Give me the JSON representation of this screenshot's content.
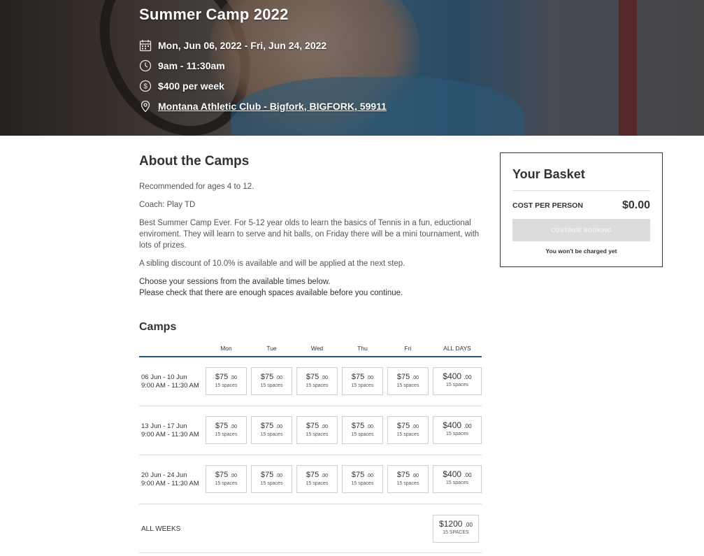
{
  "hero": {
    "title": "Summer Camp 2022",
    "dates": "Mon, Jun 06, 2022 - Fri, Jun 24, 2022",
    "time": "9am - 11:30am",
    "price": "$400 per week",
    "location": "Montana Athletic Club - Bigfork, BIGFORK, 59911",
    "icons": [
      "calendar-icon",
      "clock-icon",
      "dollar-icon",
      "location-pin-icon"
    ]
  },
  "about": {
    "heading": "About the Camps",
    "ages": "Recommended for ages 4 to 12.",
    "coach": "Coach: Play TD",
    "description": "Best Summer Camp Ever. For 5-12 year olds to learn the basics of Tennis in a fun, eductional enviroment. They will learn to serve and hit balls, on Friday there will be a mini tournament, with lots of prizes.",
    "discount": "A sibling discount of 10.0% is available and will be applied at the next step.",
    "instruction_1": "Choose your sessions from the available times below.",
    "instruction_2": "Please check that there are enough spaces available before you continue."
  },
  "basket": {
    "title": "Your Basket",
    "cost_label": "COST PER PERSON",
    "cost_value": "$0.00",
    "continue_label": "CONTINUE BOOKING",
    "note": "You won't be charged yet"
  },
  "camps": {
    "title": "Camps",
    "headers": [
      "Mon",
      "Tue",
      "Wed",
      "Thu",
      "Fri",
      "ALL DAYS"
    ],
    "weeks": [
      {
        "dates": "06 Jun - 10 Jun",
        "time": "9:00 AM - 11:30 AM",
        "slots": [
          {
            "dollars": "$75",
            "cents": ".00",
            "spaces": "15 spaces"
          },
          {
            "dollars": "$75",
            "cents": ".00",
            "spaces": "15 spaces"
          },
          {
            "dollars": "$75",
            "cents": ".00",
            "spaces": "15 spaces"
          },
          {
            "dollars": "$75",
            "cents": ".00",
            "spaces": "15 spaces"
          },
          {
            "dollars": "$75",
            "cents": ".00",
            "spaces": "15 spaces"
          }
        ],
        "all_days": {
          "dollars": "$400",
          "cents": ".00",
          "spaces": "15 spaces"
        }
      },
      {
        "dates": "13 Jun - 17 Jun",
        "time": "9:00 AM - 11:30 AM",
        "slots": [
          {
            "dollars": "$75",
            "cents": ".00",
            "spaces": "15 spaces"
          },
          {
            "dollars": "$75",
            "cents": ".00",
            "spaces": "15 spaces"
          },
          {
            "dollars": "$75",
            "cents": ".00",
            "spaces": "15 spaces"
          },
          {
            "dollars": "$75",
            "cents": ".00",
            "spaces": "15 spaces"
          },
          {
            "dollars": "$75",
            "cents": ".00",
            "spaces": "15 spaces"
          }
        ],
        "all_days": {
          "dollars": "$400",
          "cents": ".00",
          "spaces": "15 spaces"
        }
      },
      {
        "dates": "20 Jun - 24 Jun",
        "time": "9:00 AM - 11:30 AM",
        "slots": [
          {
            "dollars": "$75",
            "cents": ".00",
            "spaces": "15 spaces"
          },
          {
            "dollars": "$75",
            "cents": ".00",
            "spaces": "15 spaces"
          },
          {
            "dollars": "$75",
            "cents": ".00",
            "spaces": "15 spaces"
          },
          {
            "dollars": "$75",
            "cents": ".00",
            "spaces": "15 spaces"
          },
          {
            "dollars": "$75",
            "cents": ".00",
            "spaces": "15 spaces"
          }
        ],
        "all_days": {
          "dollars": "$400",
          "cents": ".00",
          "spaces": "15 spaces"
        }
      }
    ],
    "all_weeks": {
      "label": "ALL WEEKS",
      "dollars": "$1200",
      "cents": ".00",
      "spaces": "15 SPACES"
    }
  },
  "colors": {
    "table_header_rule": "#2b5876",
    "basket_border": "#333333",
    "disabled_button": "#dcdcdc"
  }
}
